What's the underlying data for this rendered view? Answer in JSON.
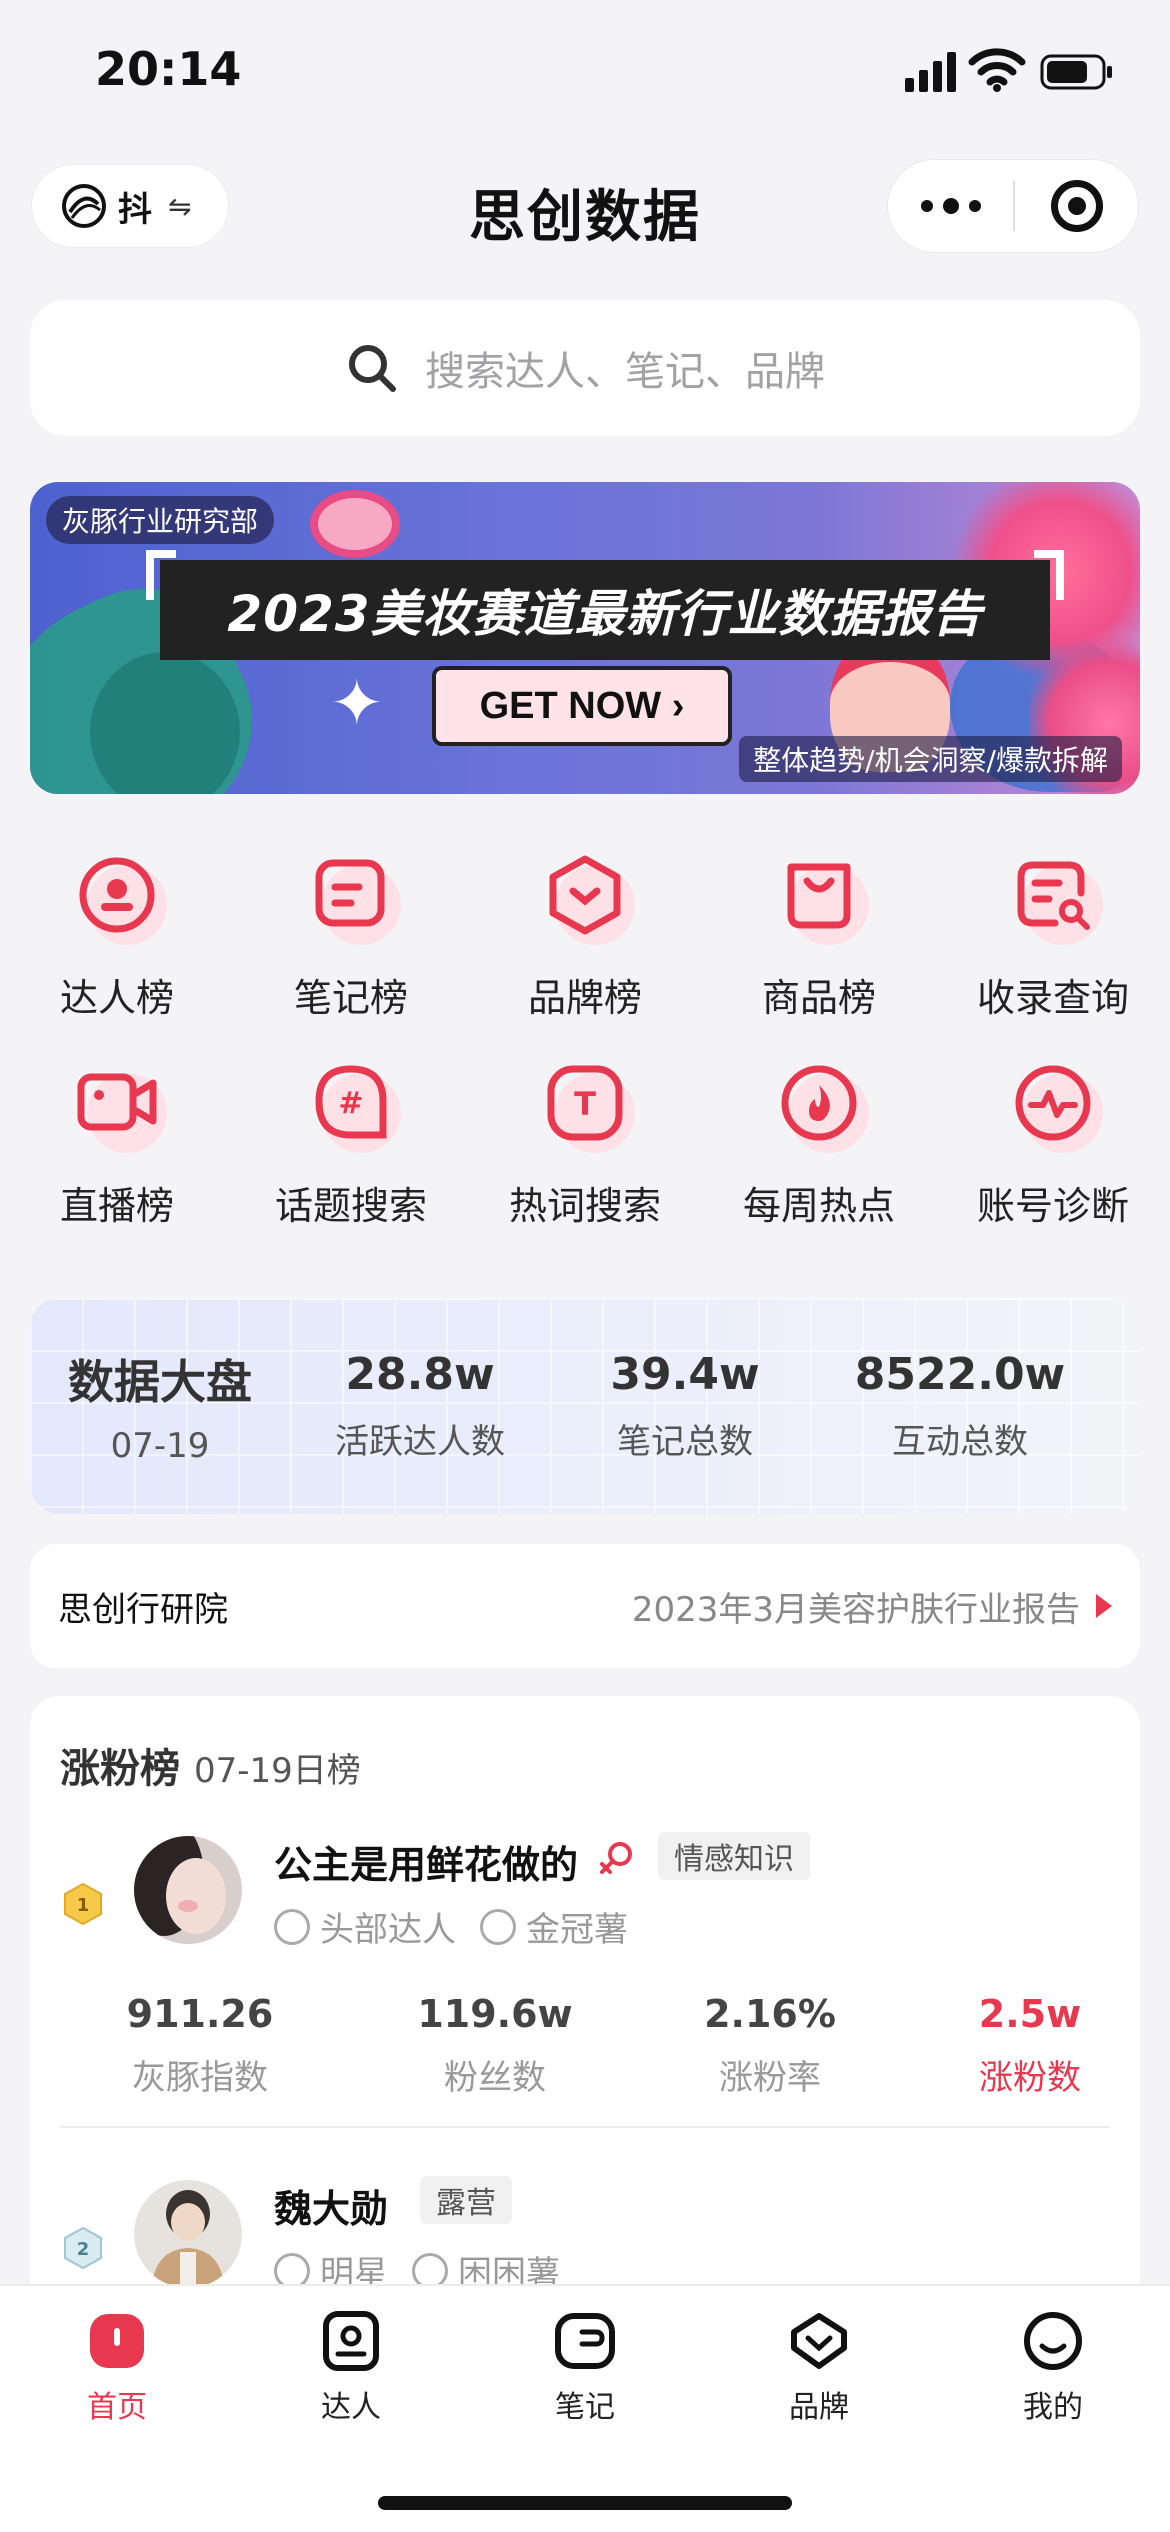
{
  "status_bar": {
    "time": "20:14"
  },
  "header": {
    "platform_label": "抖",
    "platform_swap_glyph": "⇋",
    "title": "思创数据"
  },
  "search": {
    "placeholder": "搜索达人、笔记、品牌"
  },
  "banner": {
    "tag": "灰豚行业研究部",
    "headline": "2023美妆赛道最新行业数据报告",
    "cta": "GET NOW ›",
    "subline": "整体趋势/机会洞察/爆款拆解"
  },
  "grid": {
    "rows": [
      [
        {
          "label": "达人榜",
          "icon": "influencer-rank-icon"
        },
        {
          "label": "笔记榜",
          "icon": "note-rank-icon"
        },
        {
          "label": "品牌榜",
          "icon": "brand-rank-icon"
        },
        {
          "label": "商品榜",
          "icon": "product-rank-icon"
        },
        {
          "label": "收录查询",
          "icon": "index-query-icon"
        }
      ],
      [
        {
          "label": "直播榜",
          "icon": "live-rank-icon"
        },
        {
          "label": "话题搜索",
          "icon": "topic-search-icon"
        },
        {
          "label": "热词搜索",
          "icon": "hotword-search-icon"
        },
        {
          "label": "每周热点",
          "icon": "weekly-hot-icon"
        },
        {
          "label": "账号诊断",
          "icon": "account-diagnosis-icon"
        }
      ]
    ]
  },
  "stats": {
    "title": "数据大盘",
    "date": "07-19",
    "items": [
      {
        "value": "28.8w",
        "label": "活跃达人数"
      },
      {
        "value": "39.4w",
        "label": "笔记总数"
      },
      {
        "value": "8522.0w",
        "label": "互动总数"
      }
    ]
  },
  "research": {
    "label": "思创行研院",
    "link": "2023年3月美容护肤行业报告"
  },
  "ranking": {
    "title": "涨粉榜",
    "subtitle": "07-19日榜",
    "entries": [
      {
        "rank": "1",
        "name": "公主是用鲜花做的",
        "badge": "情感知识",
        "meta": [
          "头部达人",
          "金冠薯"
        ],
        "metrics": [
          {
            "value": "911.26",
            "label": "灰豚指数"
          },
          {
            "value": "119.6w",
            "label": "粉丝数"
          },
          {
            "value": "2.16%",
            "label": "涨粉率"
          },
          {
            "value": "2.5w",
            "label": "涨粉数"
          }
        ]
      },
      {
        "rank": "2",
        "name": "魏大勋",
        "badge": "露营",
        "meta": [
          "明星",
          "困困薯"
        ]
      }
    ]
  },
  "tabbar": {
    "tabs": [
      {
        "label": "首页",
        "icon": "home-icon",
        "active": true
      },
      {
        "label": "达人",
        "icon": "influencer-icon"
      },
      {
        "label": "笔记",
        "icon": "note-icon"
      },
      {
        "label": "品牌",
        "icon": "brand-icon"
      },
      {
        "label": "我的",
        "icon": "profile-icon"
      }
    ]
  },
  "colors": {
    "accent": "#e8384f",
    "icon_tint": "#fde1e6"
  }
}
